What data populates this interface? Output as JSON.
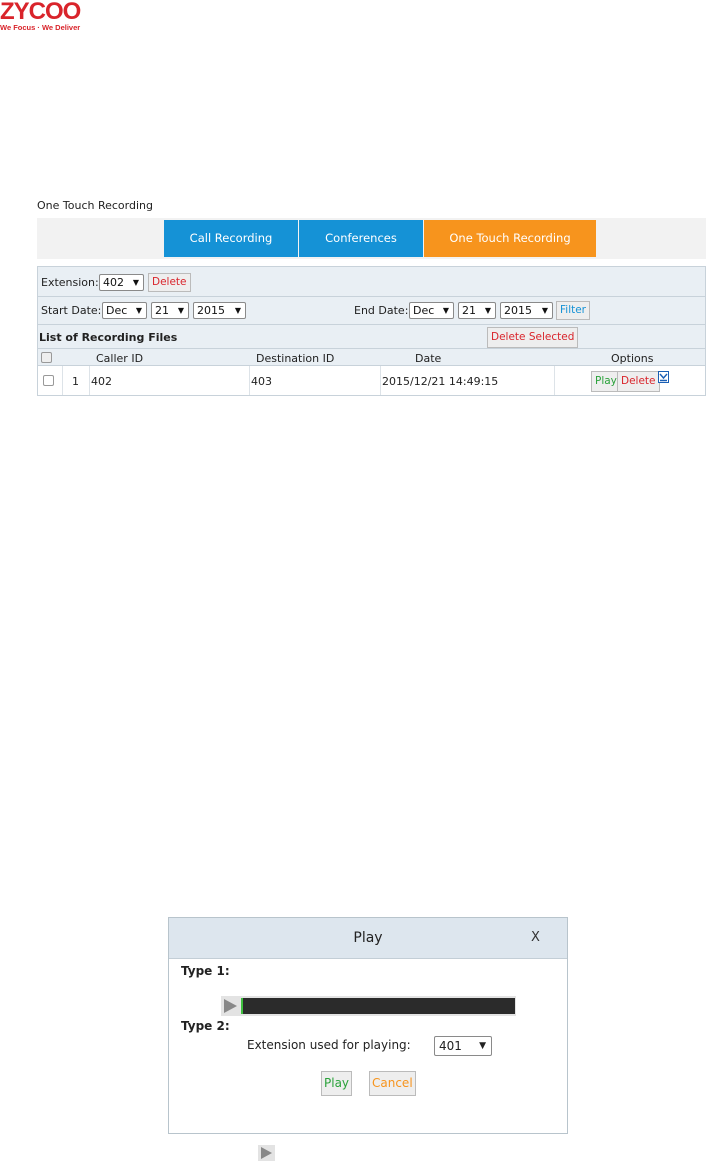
{
  "brand": {
    "name": "ZYCOO",
    "tagline": "We Focus · We Deliver",
    "color": "#d9242b"
  },
  "panel": {
    "title": "One Touch Recording",
    "tabs": [
      {
        "label": "Call Recording",
        "color": "#1592d6"
      },
      {
        "label": "Conferences",
        "color": "#1592d6"
      },
      {
        "label": "One Touch Recording",
        "color": "#f7941d",
        "active": true
      }
    ],
    "extension": {
      "label": "Extension:",
      "value": "402",
      "delete_label": "Delete"
    },
    "start_date": {
      "label": "Start Date:",
      "month": "Dec",
      "day": "21",
      "year": "2015"
    },
    "end_date": {
      "label": "End Date:",
      "month": "Dec",
      "day": "21",
      "year": "2015",
      "filter_label": "Filter"
    },
    "list": {
      "title": "List of Recording Files",
      "delete_selected_label": "Delete Selected",
      "columns": [
        "Caller ID",
        "Destination ID",
        "Date",
        "Options"
      ],
      "rows": [
        {
          "index": "1",
          "caller_id": "402",
          "destination_id": "403",
          "date": "2015/12/21 14:49:15",
          "play_label": "Play",
          "delete_label": "Delete"
        }
      ]
    }
  },
  "dialog": {
    "title": "Play",
    "close_label": "X",
    "type1_label": "Type 1:",
    "type2_label": "Type 2:",
    "extension_label": "Extension used for playing:",
    "extension_value": "401",
    "play_label": "Play",
    "cancel_label": "Cancel"
  }
}
